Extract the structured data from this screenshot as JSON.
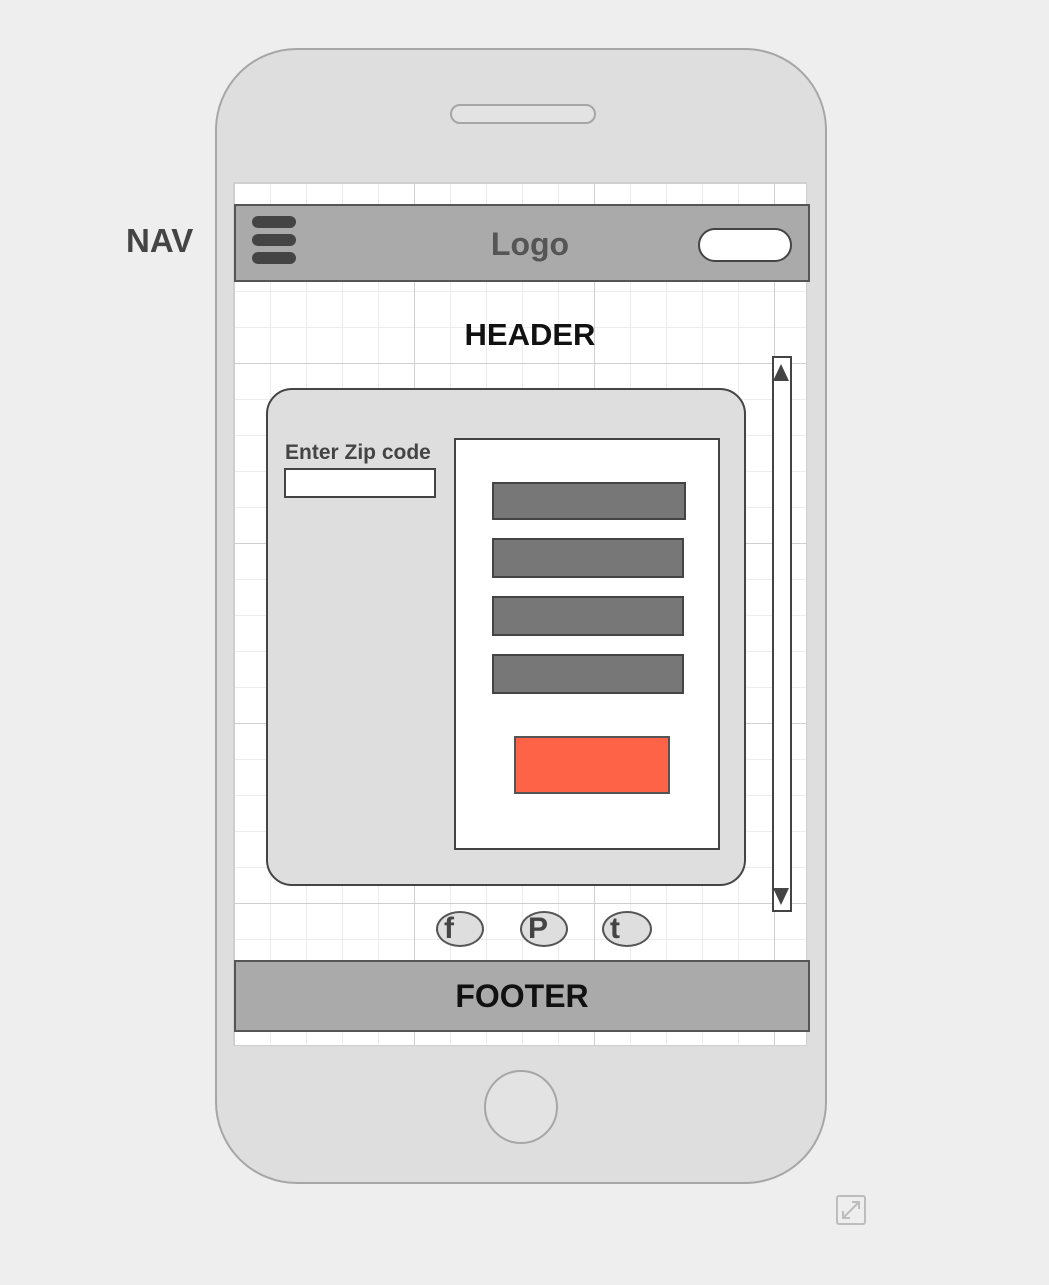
{
  "annotations": {
    "nav_label": "NAV"
  },
  "navbar": {
    "logo": "Logo",
    "menu_icon": "hamburger-menu-icon"
  },
  "header": {
    "title": "HEADER"
  },
  "form": {
    "zip_label": "Enter Zip code",
    "zip_value": "",
    "zip_placeholder": ""
  },
  "results": {
    "item_count": 4
  },
  "social": {
    "facebook": "f",
    "pinterest": "P",
    "twitter": "t"
  },
  "footer": {
    "title": "FOOTER"
  },
  "colors": {
    "accent": "#ff6347",
    "bar_fill": "#aaaaaa",
    "phone_body": "#dedede",
    "result_bar": "#777777"
  },
  "icons": {
    "expand": "expand-icon",
    "scroll_up": "scroll-up-arrow-icon",
    "scroll_down": "scroll-down-arrow-icon"
  }
}
